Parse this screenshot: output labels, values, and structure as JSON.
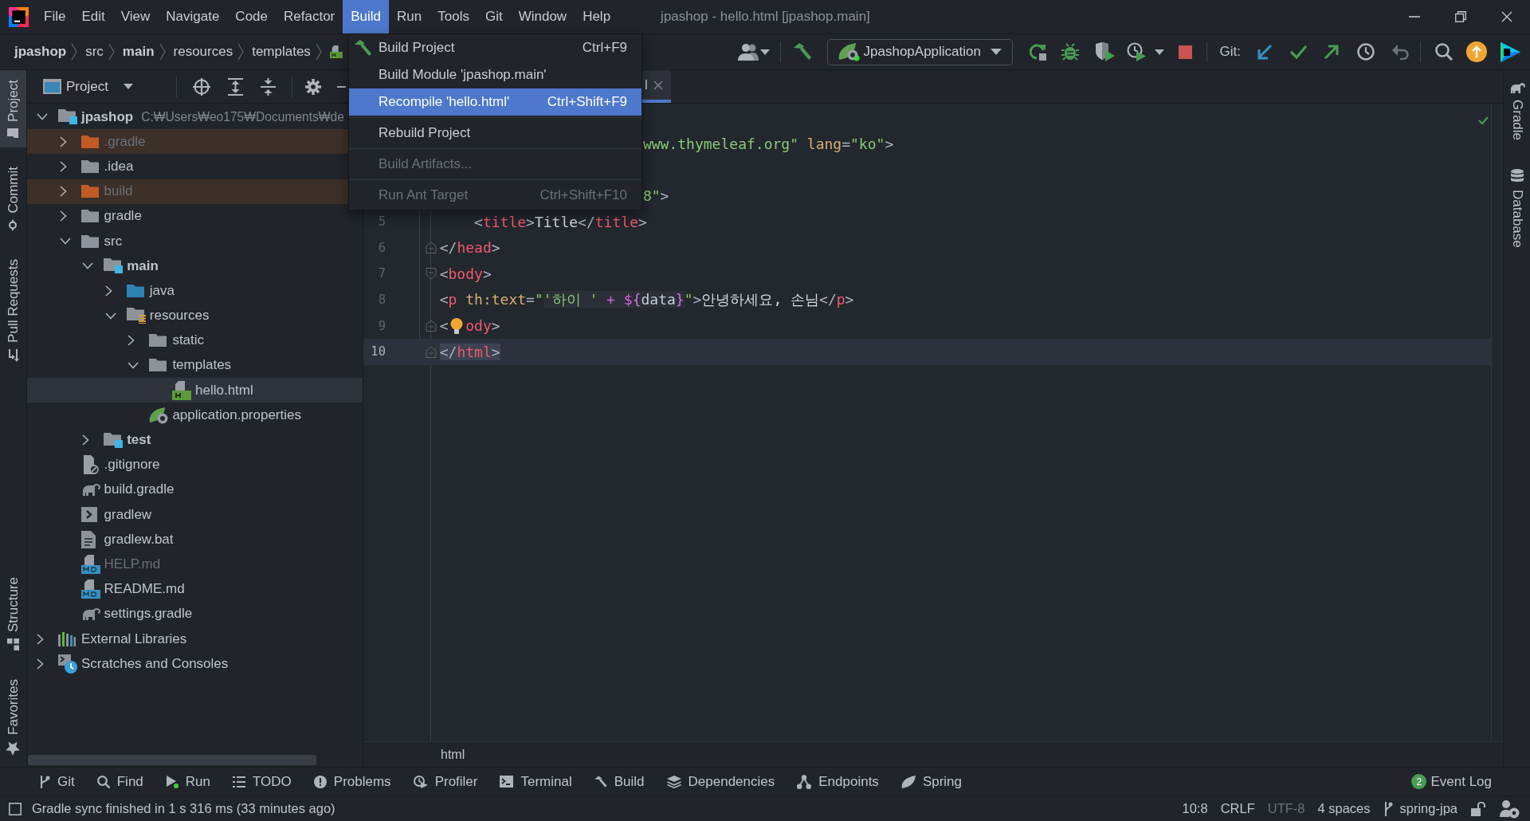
{
  "window": {
    "title": "jpashop - hello.html [jpashop.main]"
  },
  "menubar": [
    {
      "label": "File",
      "selected": false
    },
    {
      "label": "Edit",
      "selected": false
    },
    {
      "label": "View",
      "selected": false
    },
    {
      "label": "Navigate",
      "selected": false
    },
    {
      "label": "Code",
      "selected": false
    },
    {
      "label": "Refactor",
      "selected": false
    },
    {
      "label": "Build",
      "selected": true
    },
    {
      "label": "Run",
      "selected": false
    },
    {
      "label": "Tools",
      "selected": false
    },
    {
      "label": "Git",
      "selected": false
    },
    {
      "label": "Window",
      "selected": false
    },
    {
      "label": "Help",
      "selected": false
    }
  ],
  "breadcrumbs": [
    {
      "label": "jpashop",
      "kind": "module"
    },
    {
      "label": "src",
      "kind": "folder"
    },
    {
      "label": "main",
      "kind": "module"
    },
    {
      "label": "resources",
      "kind": "folder"
    },
    {
      "label": "templates",
      "kind": "folder"
    },
    {
      "kind": "html"
    }
  ],
  "toolbar": {
    "run_configuration": "JpashopApplication",
    "vcs_label": "Git:"
  },
  "left_strip": {
    "top": [
      {
        "label": "Project",
        "kind": "project",
        "selected": true
      },
      {
        "label": "Commit",
        "kind": "commit",
        "selected": false
      },
      {
        "label": "Pull Requests",
        "kind": "pull-requests",
        "selected": false
      }
    ],
    "bottom": [
      {
        "label": "Structure",
        "kind": "structure",
        "selected": false
      },
      {
        "label": "Favorites",
        "kind": "favorites",
        "selected": false
      }
    ]
  },
  "right_strip": [
    {
      "label": "Gradle",
      "kind": "gradle",
      "selected": false
    },
    {
      "label": "Database",
      "kind": "database",
      "selected": false
    }
  ],
  "project_panel": {
    "title": "Project",
    "tree": [
      {
        "label": "jpashop",
        "path": "C:₩Users₩eo175₩Documents₩de",
        "kind": "module",
        "expanded": true,
        "selected": false,
        "excluded": false,
        "dimmed": false,
        "children": [
          {
            "label": ".gradle",
            "kind": "folder",
            "expanded": false,
            "selected": false,
            "excluded": true,
            "dimmed": true
          },
          {
            "label": ".idea",
            "kind": "folder",
            "expanded": false,
            "selected": false,
            "excluded": false,
            "dimmed": false
          },
          {
            "label": "build",
            "kind": "folder",
            "expanded": false,
            "selected": false,
            "excluded": true,
            "dimmed": true
          },
          {
            "label": "gradle",
            "kind": "folder",
            "expanded": false,
            "selected": false,
            "excluded": false,
            "dimmed": false
          },
          {
            "label": "src",
            "kind": "folder",
            "expanded": true,
            "selected": false,
            "excluded": false,
            "dimmed": false,
            "children": [
              {
                "label": "main",
                "kind": "module",
                "expanded": true,
                "selected": false,
                "excluded": false,
                "dimmed": false,
                "children": [
                  {
                    "label": "java",
                    "kind": "source-root",
                    "expanded": false,
                    "selected": false,
                    "excluded": false,
                    "dimmed": false
                  },
                  {
                    "label": "resources",
                    "kind": "resources-root",
                    "expanded": true,
                    "selected": false,
                    "excluded": false,
                    "dimmed": false,
                    "children": [
                      {
                        "label": "static",
                        "kind": "folder",
                        "expanded": false,
                        "selected": false,
                        "excluded": false,
                        "dimmed": false
                      },
                      {
                        "label": "templates",
                        "kind": "folder",
                        "expanded": true,
                        "selected": false,
                        "excluded": false,
                        "dimmed": false,
                        "children": [
                          {
                            "label": "hello.html",
                            "kind": "html",
                            "selected": true,
                            "excluded": false,
                            "dimmed": false
                          }
                        ]
                      },
                      {
                        "label": "application.properties",
                        "kind": "properties",
                        "selected": false,
                        "excluded": false,
                        "dimmed": false
                      }
                    ]
                  }
                ]
              },
              {
                "label": "test",
                "kind": "module",
                "expanded": false,
                "selected": false,
                "excluded": false,
                "dimmed": false
              }
            ]
          },
          {
            "label": ".gitignore",
            "kind": "gitignore",
            "selected": false,
            "excluded": false,
            "dimmed": false
          },
          {
            "label": "build.gradle",
            "kind": "gradle",
            "selected": false,
            "excluded": false,
            "dimmed": false
          },
          {
            "label": "gradlew",
            "kind": "shell",
            "selected": false,
            "excluded": false,
            "dimmed": false
          },
          {
            "label": "gradlew.bat",
            "kind": "text",
            "selected": false,
            "excluded": false,
            "dimmed": false
          },
          {
            "label": "HELP.md",
            "kind": "markdown",
            "selected": false,
            "excluded": false,
            "dimmed": true
          },
          {
            "label": "README.md",
            "kind": "markdown",
            "selected": false,
            "excluded": false,
            "dimmed": false
          },
          {
            "label": "settings.gradle",
            "kind": "gradle",
            "selected": false,
            "excluded": false,
            "dimmed": false
          }
        ]
      },
      {
        "label": "External Libraries",
        "kind": "libraries",
        "expanded": false,
        "selected": false,
        "excluded": false,
        "dimmed": false
      },
      {
        "label": "Scratches and Consoles",
        "kind": "scratches",
        "expanded": false,
        "selected": false,
        "excluded": false,
        "dimmed": false
      }
    ]
  },
  "editor": {
    "tabs": [
      {
        "label": "l",
        "selected": true
      }
    ],
    "lines": [
      {
        "kind": "plain",
        "covered": true,
        "current": false,
        "tokens": [
          {
            "text": "www.thymeleaf.org\"",
            "kind": "string"
          },
          {
            "text": " lang",
            "kind": "attr"
          },
          {
            "text": "=",
            "kind": "punct"
          },
          {
            "text": "\"ko\"",
            "kind": "string"
          },
          {
            "text": ">",
            "kind": "punct"
          }
        ]
      },
      {
        "kind": "plain",
        "covered": true,
        "current": false,
        "tokens": [
          {
            "text": "8\"",
            "kind": "string"
          },
          {
            "text": ">",
            "kind": "punct"
          }
        ]
      },
      {
        "number": "5",
        "kind": "plain",
        "covered": false,
        "current": false,
        "tokens": [
          {
            "text": "    <",
            "kind": "punct"
          },
          {
            "text": "title",
            "kind": "tag"
          },
          {
            "text": ">",
            "kind": "punct"
          },
          {
            "text": "Title",
            "kind": "text"
          },
          {
            "text": "</",
            "kind": "punct"
          },
          {
            "text": "title",
            "kind": "tag"
          },
          {
            "text": ">",
            "kind": "punct"
          }
        ]
      },
      {
        "number": "6",
        "kind": "fold-end",
        "covered": false,
        "current": false,
        "tokens": [
          {
            "text": "</",
            "kind": "punct"
          },
          {
            "text": "head",
            "kind": "tag"
          },
          {
            "text": ">",
            "kind": "punct"
          }
        ]
      },
      {
        "number": "7",
        "kind": "fold-start",
        "covered": false,
        "current": false,
        "tokens": [
          {
            "text": "<",
            "kind": "punct"
          },
          {
            "text": "body",
            "kind": "tag"
          },
          {
            "text": ">",
            "kind": "punct"
          }
        ]
      },
      {
        "number": "8",
        "kind": "plain",
        "covered": false,
        "current": false,
        "tokens": [
          {
            "text": "<",
            "kind": "punct"
          },
          {
            "text": "p",
            "kind": "tag"
          },
          {
            "text": " th:text",
            "kind": "attr"
          },
          {
            "text": "=",
            "kind": "punct"
          },
          {
            "text": "\"",
            "kind": "string"
          },
          {
            "kind": "injection",
            "tokens": [
              {
                "text": "'하이 '",
                "kind": "string"
              },
              {
                "text": " + $",
                "kind": "op"
              },
              {
                "text": "{",
                "kind": "brace"
              },
              {
                "text": "data",
                "kind": "ident"
              },
              {
                "text": "}",
                "kind": "brace"
              }
            ]
          },
          {
            "text": "\"",
            "kind": "string"
          },
          {
            "text": ">",
            "kind": "punct"
          },
          {
            "text": "안녕하세요, 손님",
            "kind": "text"
          },
          {
            "text": "</",
            "kind": "punct"
          },
          {
            "text": "p",
            "kind": "tag"
          },
          {
            "text": ">",
            "kind": "punct"
          }
        ]
      },
      {
        "number": "9",
        "kind": "fold-end",
        "covered": false,
        "current": false,
        "tokens": [
          {
            "text": "<",
            "kind": "punct"
          },
          {
            "kind": "bulb"
          },
          {
            "text": "ody",
            "kind": "tag"
          },
          {
            "text": ">",
            "kind": "punct"
          }
        ]
      },
      {
        "number": "10",
        "kind": "fold-end",
        "covered": false,
        "current": true,
        "tokens": [
          {
            "kind": "match",
            "tokens": [
              {
                "text": "</",
                "kind": "punct"
              },
              {
                "text": "html",
                "kind": "tag"
              },
              {
                "text": ">",
                "kind": "punct"
              }
            ]
          }
        ]
      }
    ],
    "breadcrumb": "html"
  },
  "build_menu": {
    "groups": [
      {
        "items": [
          {
            "label": "Build Project",
            "shortcut": "Ctrl+F9",
            "kind": "build",
            "selected": false,
            "disabled": false
          },
          {
            "label": "Build Module 'jpashop.main'",
            "kind": "command",
            "selected": false,
            "disabled": false
          },
          {
            "label": "Recompile 'hello.html'",
            "shortcut": "Ctrl+Shift+F9",
            "kind": "command",
            "selected": true,
            "disabled": false
          }
        ]
      },
      {
        "items": [
          {
            "label": "Rebuild Project",
            "kind": "command",
            "selected": false,
            "disabled": false
          }
        ]
      },
      {
        "items": [
          {
            "label": "Build Artifacts...",
            "kind": "command",
            "selected": false,
            "disabled": true
          }
        ]
      },
      {
        "items": [
          {
            "label": "Run Ant Target",
            "shortcut": "Ctrl+Shift+F10",
            "kind": "command",
            "selected": false,
            "disabled": true
          }
        ]
      }
    ]
  },
  "tool_window_bar": {
    "left": [
      {
        "label": "Git",
        "kind": "git",
        "running": false
      },
      {
        "label": "Find",
        "kind": "find",
        "running": false
      },
      {
        "label": "Run",
        "kind": "run",
        "running": true
      },
      {
        "label": "TODO",
        "kind": "todo",
        "running": false
      },
      {
        "label": "Problems",
        "kind": "problems",
        "running": false
      },
      {
        "label": "Profiler",
        "kind": "profiler",
        "running": false
      },
      {
        "label": "Terminal",
        "kind": "terminal",
        "running": false
      },
      {
        "label": "Build",
        "kind": "build",
        "running": false
      },
      {
        "label": "Dependencies",
        "kind": "dependencies",
        "running": false
      },
      {
        "label": "Endpoints",
        "kind": "endpoints",
        "running": false
      },
      {
        "label": "Spring",
        "kind": "spring",
        "running": false
      }
    ],
    "right": [
      {
        "label": "Event Log",
        "count": "2"
      }
    ]
  },
  "status_bar": {
    "message": "Gradle sync finished in 1 s 316 ms (33 minutes ago)",
    "widgets": [
      {
        "label": "10:8",
        "disabled": false
      },
      {
        "label": "CRLF",
        "disabled": false
      },
      {
        "label": "UTF-8",
        "disabled": true
      },
      {
        "label": "4 spaces",
        "disabled": false
      }
    ],
    "branch": "spring-jpa"
  }
}
